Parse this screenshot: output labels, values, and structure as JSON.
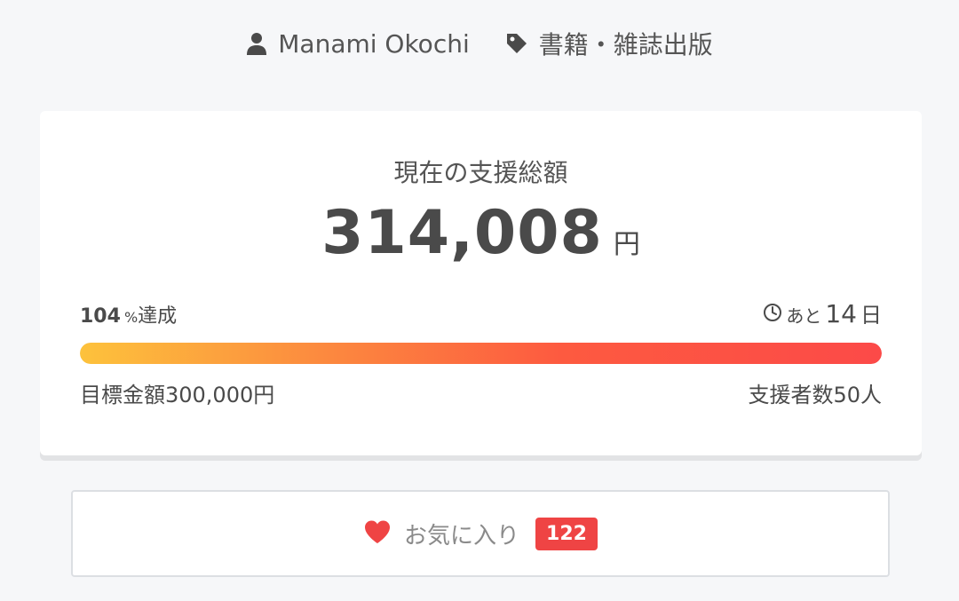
{
  "project": {
    "owner": {
      "name": "Manami Okochi",
      "icon": "user-icon"
    },
    "category": {
      "label": "書籍・雑誌出版",
      "icon": "tag-icon"
    }
  },
  "funding": {
    "label": "現在の支援総額",
    "amount": "314,008",
    "unit": "円",
    "achieved_percent_text": "104",
    "achieved_percent_symbol": "%",
    "achieved_label": "達成",
    "progress_fraction": 1.0,
    "remaining_prefix": "あと",
    "remaining_days": "14",
    "remaining_suffix": "日",
    "goal_text": "目標金額300,000円",
    "supporters_text": "支援者数50人"
  },
  "favorite": {
    "label": "お気に入り",
    "count": "122",
    "icon": "heart-icon"
  },
  "colors": {
    "background": "#f6f7f9",
    "progress_start": "#fdc23c",
    "progress_end": "#fc4a48",
    "badge": "#ef4444",
    "heart": "#ef4444"
  }
}
